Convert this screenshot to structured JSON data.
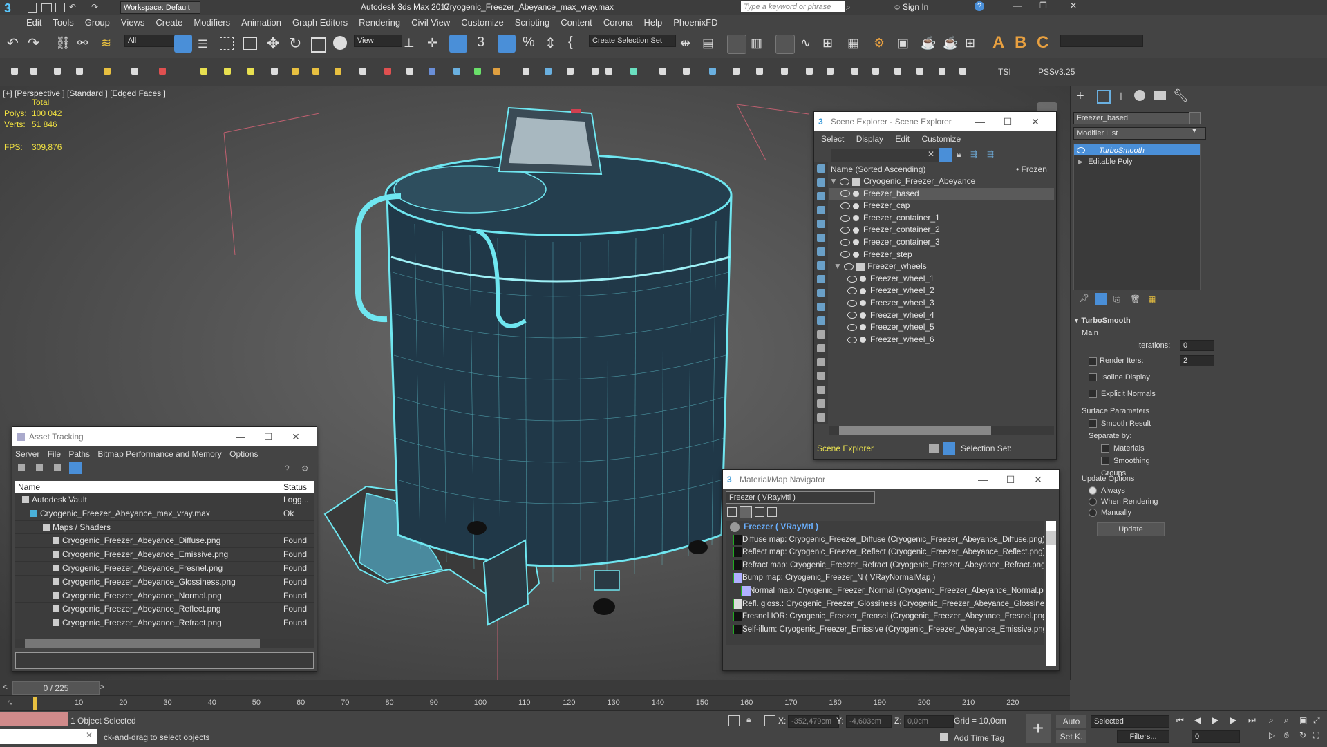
{
  "window": {
    "app_title": "Autodesk 3ds Max 2017",
    "file_title": "Cryogenic_Freezer_Abeyance_max_vray.max",
    "workspace": "Workspace: Default",
    "search_placeholder": "Type a keyword or phrase",
    "sign_in": "Sign In"
  },
  "menu": [
    "Edit",
    "Tools",
    "Group",
    "Views",
    "Create",
    "Modifiers",
    "Animation",
    "Graph Editors",
    "Rendering",
    "Civil View",
    "Customize",
    "Scripting",
    "Content",
    "Corona",
    "Help",
    "PhoenixFD"
  ],
  "toolbar": {
    "filter_select": "All",
    "view_select": "View",
    "selection_set": "Create Selection Set",
    "tsi_label": "TSI",
    "pss_label": "PSSv3.25"
  },
  "viewport": {
    "label": "[+] [Perspective ] [Standard ] [Edged Faces ]",
    "total_label": "Total",
    "polys_label": "Polys:",
    "polys_value": "100 042",
    "verts_label": "Verts:",
    "verts_value": "51 846",
    "fps_label": "FPS:",
    "fps_value": "309,876"
  },
  "scene_explorer": {
    "title": "Scene Explorer - Scene Explorer",
    "menu": [
      "Select",
      "Display",
      "Edit",
      "Customize"
    ],
    "col_name": "Name (Sorted Ascending)",
    "col_frozen": "• Frozen",
    "root": "Cryogenic_Freezer_Abeyance",
    "items": [
      "Freezer_based",
      "Freezer_cap",
      "Freezer_container_1",
      "Freezer_container_2",
      "Freezer_container_3",
      "Freezer_step"
    ],
    "group": "Freezer_wheels",
    "wheels": [
      "Freezer_wheel_1",
      "Freezer_wheel_2",
      "Freezer_wheel_3",
      "Freezer_wheel_4",
      "Freezer_wheel_5",
      "Freezer_wheel_6"
    ],
    "footer_label": "Scene Explorer",
    "selection_set_label": "Selection Set:"
  },
  "asset_tracking": {
    "title": "Asset Tracking",
    "menu": [
      "Server",
      "File",
      "Paths",
      "Bitmap Performance and Memory",
      "Options"
    ],
    "col_name": "Name",
    "col_status": "Status",
    "rows": [
      {
        "name": "Autodesk Vault",
        "status": "Logg..."
      },
      {
        "name": "Cryogenic_Freezer_Abeyance_max_vray.max",
        "status": "Ok"
      },
      {
        "name": "Maps / Shaders",
        "status": ""
      },
      {
        "name": "Cryogenic_Freezer_Abeyance_Diffuse.png",
        "status": "Found"
      },
      {
        "name": "Cryogenic_Freezer_Abeyance_Emissive.png",
        "status": "Found"
      },
      {
        "name": "Cryogenic_Freezer_Abeyance_Fresnel.png",
        "status": "Found"
      },
      {
        "name": "Cryogenic_Freezer_Abeyance_Glossiness.png",
        "status": "Found"
      },
      {
        "name": "Cryogenic_Freezer_Abeyance_Normal.png",
        "status": "Found"
      },
      {
        "name": "Cryogenic_Freezer_Abeyance_Reflect.png",
        "status": "Found"
      },
      {
        "name": "Cryogenic_Freezer_Abeyance_Refract.png",
        "status": "Found"
      }
    ]
  },
  "material_navigator": {
    "title": "Material/Map Navigator",
    "field": "Freezer  ( VRayMtl )",
    "root": "Freezer  ( VRayMtl )",
    "maps": [
      "Diffuse map: Cryogenic_Freezer_Diffuse (Cryogenic_Freezer_Abeyance_Diffuse.png)",
      "Reflect map: Cryogenic_Freezer_Reflect (Cryogenic_Freezer_Abeyance_Reflect.png)",
      "Refract map: Cryogenic_Freezer_Refract (Cryogenic_Freezer_Abeyance_Refract.png)",
      "Bump map: Cryogenic_Freezer_N  ( VRayNormalMap )",
      "Normal map: Cryogenic_Freezer_Normal (Cryogenic_Freezer_Abeyance_Normal.png)",
      "Refl. gloss.: Cryogenic_Freezer_Glossiness (Cryogenic_Freezer_Abeyance_Glossiness.png)",
      "Fresnel IOR: Cryogenic_Freezer_Frensel (Cryogenic_Freezer_Abeyance_Fresnel.png)",
      "Self-illum: Cryogenic_Freezer_Emissive (Cryogenic_Freezer_Abeyance_Emissive.png)"
    ]
  },
  "command_panel": {
    "object_name": "Freezer_based",
    "modifier_list": "Modifier List",
    "stack": [
      "TurboSmooth",
      "Editable Poly"
    ],
    "rollout": "TurboSmooth",
    "main": "Main",
    "iterations_label": "Iterations:",
    "iterations_value": "0",
    "render_iters_label": "Render Iters:",
    "render_iters_value": "2",
    "isoline": "Isoline Display",
    "explicit_normals": "Explicit Normals",
    "surface_params": "Surface Parameters",
    "smooth_result": "Smooth Result",
    "separate_by": "Separate by:",
    "materials": "Materials",
    "smoothing_groups": "Smoothing Groups",
    "update_options": "Update Options",
    "always": "Always",
    "when_rendering": "When Rendering",
    "manually": "Manually",
    "update_btn": "Update"
  },
  "timeline": {
    "frame": "0 / 225",
    "ticks": [
      "10",
      "20",
      "30",
      "40",
      "50",
      "60",
      "70",
      "80",
      "90",
      "100",
      "110",
      "120",
      "130",
      "140",
      "150",
      "160",
      "170",
      "180",
      "190",
      "200",
      "210",
      "220"
    ]
  },
  "status": {
    "selected": "1 Object Selected",
    "prompt": "ck-and-drag to select objects",
    "x_label": "X:",
    "x_value": "-352,479cm",
    "y_label": "Y:",
    "y_value": "-4,603cm",
    "z_label": "Z:",
    "z_value": "0,0cm",
    "grid": "Grid = 10,0cm",
    "add_time_tag": "Add Time Tag",
    "auto": "Auto",
    "set_k": "Set K.",
    "selected_dd": "Selected",
    "filters": "Filters...",
    "frame_value": "0"
  },
  "colors": {
    "accent": "#4a8fd8",
    "wire": "#5fe6f0",
    "stats": "#f0e040"
  }
}
